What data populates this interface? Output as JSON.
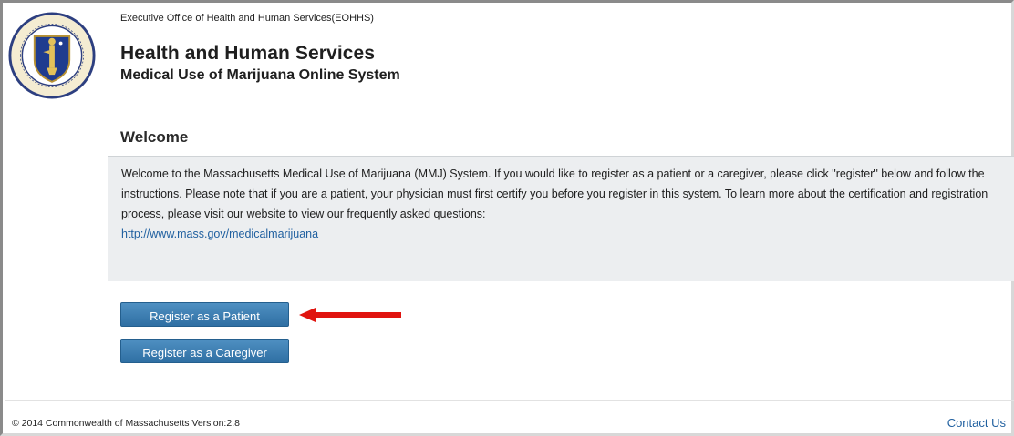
{
  "header": {
    "agency": "Executive Office of Health and Human Services(EOHHS)",
    "title": "Health and Human Services",
    "subtitle": "Medical Use of Marijuana Online System"
  },
  "seal": {
    "icon": "massachusetts-seal-icon",
    "text_top": "SIGILLUM REIPUBLICAE MASSACHUSETTENSIS"
  },
  "welcome": {
    "heading": "Welcome",
    "body": "Welcome to the Massachusetts Medical Use of Marijuana (MMJ) System. If you would like to register as a patient or a caregiver, please click \"register\" below and follow the instructions. Please note that if you are a patient, your physician must first certify you before you register in this system. To learn more about the certification and registration process, please visit our website to view our frequently asked questions:",
    "link": "http://www.mass.gov/medicalmarijuana"
  },
  "buttons": {
    "patient": "Register as a Patient",
    "caregiver": "Register as a Caregiver"
  },
  "annotation": {
    "arrow_color": "#e0140f"
  },
  "footer": {
    "copyright": "© 2014 Commonwealth of Massachusetts Version:2.8",
    "contact": "Contact Us"
  },
  "colors": {
    "button": "#3a7db2",
    "link": "#1f5f9f",
    "panel": "#eceef0"
  }
}
